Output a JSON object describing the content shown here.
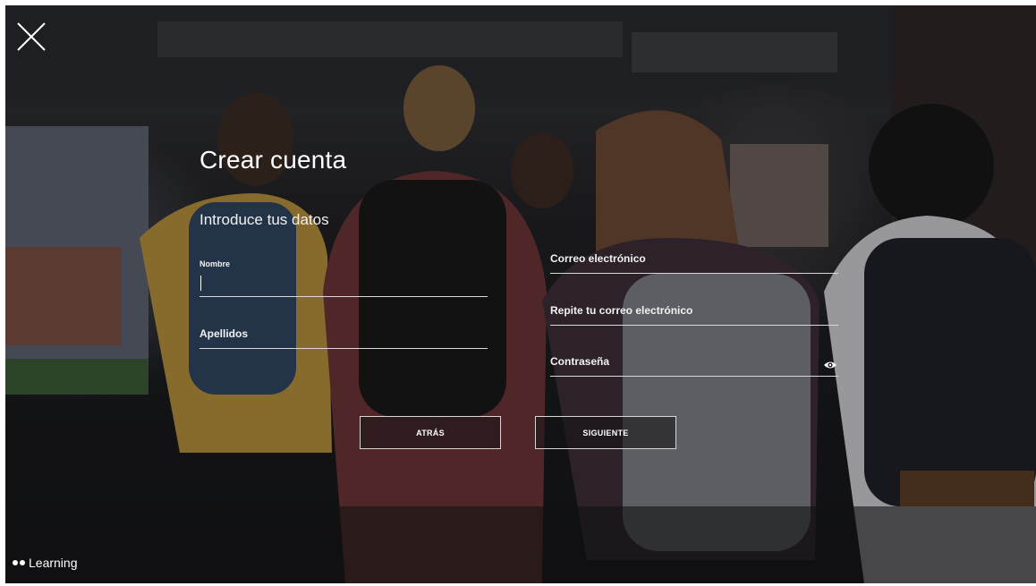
{
  "heading": {
    "title": "Crear cuenta",
    "subtitle": "Introduce tus datos"
  },
  "form": {
    "nombre": {
      "label": "Nombre",
      "value": ""
    },
    "apellidos": {
      "label": "Apellidos",
      "value": ""
    },
    "correo": {
      "label": "Correo electrónico",
      "value": ""
    },
    "correo_repeat": {
      "label": "Repite tu correo electrónico",
      "value": ""
    },
    "password": {
      "label": "Contraseña",
      "value": "",
      "toggle_icon": "eye-icon"
    }
  },
  "buttons": {
    "back": "ATRÁS",
    "next": "SIGUIENTE"
  },
  "brand": {
    "name": "Learning"
  },
  "icons": {
    "close": "close-icon",
    "logo": "logo-dots-icon"
  },
  "colors": {
    "text": "#ffffff",
    "underline": "#d9d9d9",
    "button_border": "#d6d6d6"
  }
}
